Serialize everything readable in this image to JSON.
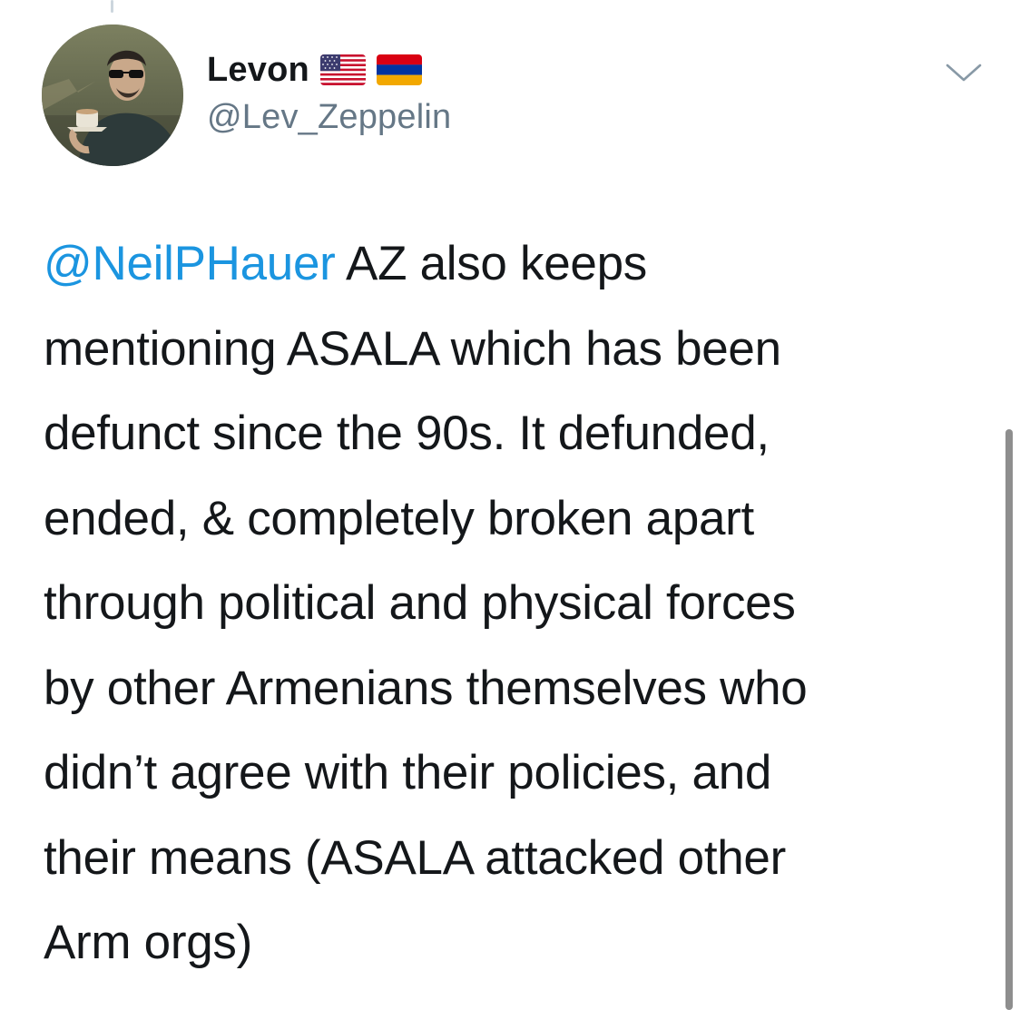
{
  "user": {
    "display_name": "Levon",
    "handle": "@Lev_Zeppelin",
    "flags": [
      "us-flag-icon",
      "armenia-flag-icon"
    ]
  },
  "tweet": {
    "mention": "@NeilPHauer",
    "lines": [
      " AZ also keeps",
      "mentioning ASALA which has been",
      "defunct since the 90s. It defunded,",
      "ended, & completely broken apart",
      "through political and physical forces",
      "by other Armenians themselves who",
      "didn’t agree with their policies, and",
      "their means (ASALA attacked other",
      "Arm orgs)"
    ]
  },
  "colors": {
    "mention": "#1b95e0",
    "text": "#14171a",
    "secondary": "#657786"
  },
  "icons": {
    "menu": "chevron-down-icon"
  }
}
